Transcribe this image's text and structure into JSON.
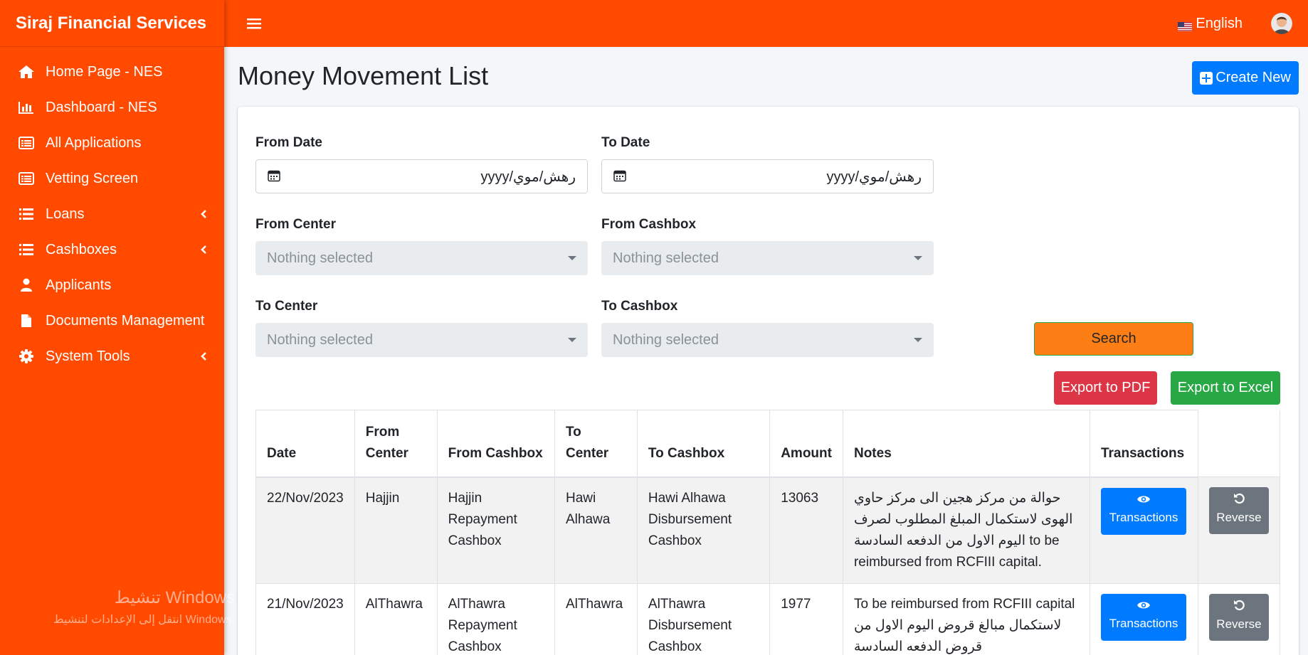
{
  "sidebar": {
    "brand": "Siraj Financial Services",
    "items": [
      {
        "label": "Home Page - NES",
        "icon": "home-icon"
      },
      {
        "label": "Dashboard - NES",
        "icon": "bar-chart-icon"
      },
      {
        "label": "All Applications",
        "icon": "list-alt-icon"
      },
      {
        "label": "Vetting Screen",
        "icon": "list-alt-icon"
      },
      {
        "label": "Loans",
        "icon": "list-icon",
        "has_children": true
      },
      {
        "label": "Cashboxes",
        "icon": "list-icon",
        "has_children": true
      },
      {
        "label": "Applicants",
        "icon": "user-icon"
      },
      {
        "label": "Documents Management",
        "icon": "file-icon"
      },
      {
        "label": "System Tools",
        "icon": "gear-icon",
        "has_children": true
      }
    ],
    "watermark_line1": "تنشيط Windows",
    "watermark_line2": "انتقل إلى الإعدادات لتنشيط Windows."
  },
  "topbar": {
    "language": "English",
    "accent": "#ff4a00"
  },
  "page": {
    "title": "Money Movement List",
    "create_label": "Create New"
  },
  "filters": {
    "from_date_label": "From Date",
    "from_date_value": "yyyy/رهش/موي",
    "to_date_label": "To Date",
    "to_date_value": "yyyy/رهش/موي",
    "from_center_label": "From Center",
    "from_center_value": "Nothing selected",
    "from_cashbox_label": "From Cashbox",
    "from_cashbox_value": "Nothing selected",
    "to_center_label": "To Center",
    "to_center_value": "Nothing selected",
    "to_cashbox_label": "To Cashbox",
    "to_cashbox_value": "Nothing selected",
    "search_label": "Search",
    "export_pdf_label": "Export to PDF",
    "export_excel_label": "Export to Excel"
  },
  "table": {
    "headers": [
      "Date",
      "From Center",
      "From Cashbox",
      "To Center",
      "To Cashbox",
      "Amount",
      "Notes",
      "Transactions"
    ],
    "rows": [
      {
        "date": "22/Nov/2023",
        "from_center": "Hajjin",
        "from_cashbox": "Hajjin Repayment Cashbox",
        "to_center": "Hawi Alhawa",
        "to_cashbox": "Hawi Alhawa Disbursement Cashbox",
        "amount": "13063",
        "notes": "حوالة من مركز هجين الى مركز حاوي الهوى لاستكمال المبلغ المطلوب لصرف اليوم الاول من الدفعه السادسة to be reimbursed from RCFIII capital.",
        "transactions_label": "Transactions",
        "reverse_label": "Reverse"
      },
      {
        "date": "21/Nov/2023",
        "from_center": "AlThawra",
        "from_cashbox": "AlThawra Repayment Cashbox",
        "to_center": "AlThawra",
        "to_cashbox": "AlThawra Disbursement Cashbox",
        "amount": "1977",
        "notes": "To be reimbursed from RCFIII capital لاستكمال مبالغ قروض اليوم الاول من قروض الدفعه السادسة",
        "transactions_label": "Transactions",
        "reverse_label": "Reverse"
      }
    ]
  }
}
